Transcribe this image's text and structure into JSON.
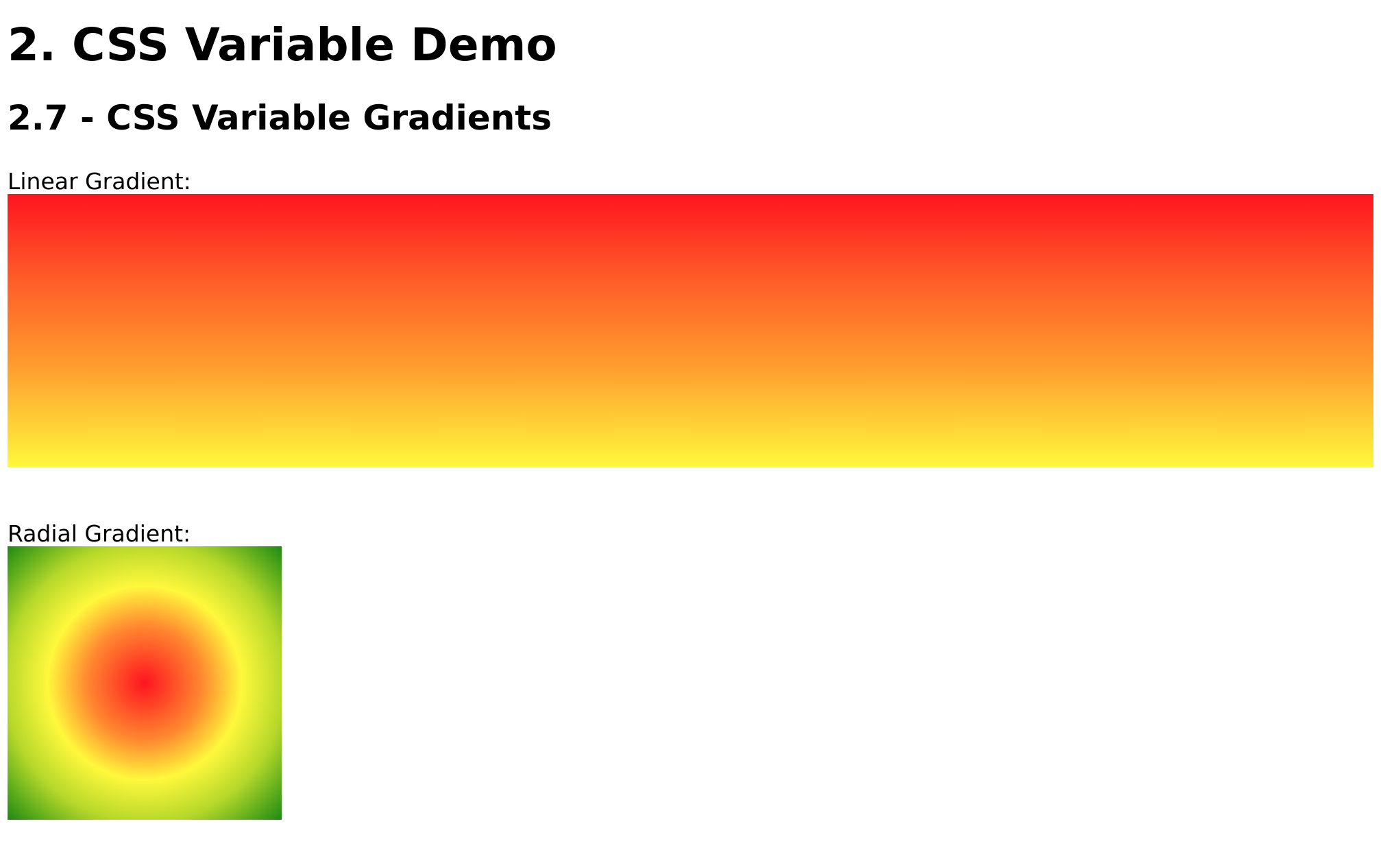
{
  "page": {
    "title": "2. CSS Variable Demo",
    "section_title": "2.7 - CSS Variable Gradients"
  },
  "linear": {
    "label": "Linear Gradient:",
    "colors": [
      "#ff1420",
      "#fff83c"
    ]
  },
  "radial": {
    "label": "Radial Gradient:",
    "colors": [
      "#ff1420",
      "#fff83c",
      "#1f8a14"
    ]
  }
}
